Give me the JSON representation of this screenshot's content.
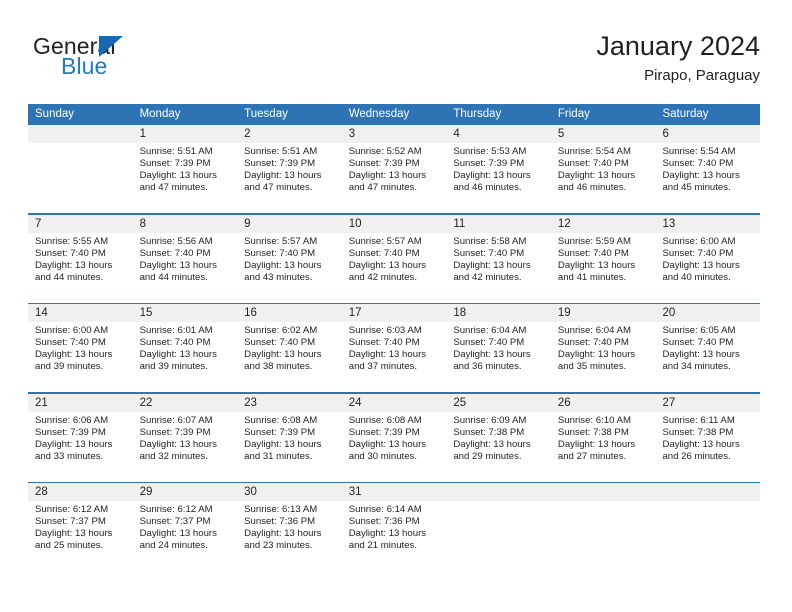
{
  "brand": {
    "name_part1": "General",
    "name_part2": "Blue",
    "accent_color": "#1668b3"
  },
  "header": {
    "title": "January 2024",
    "location": "Pirapo, Paraguay",
    "header_bg_color": "#2e74b5",
    "date_band_color": "#f0f0f0"
  },
  "weekday_headers": [
    "Sunday",
    "Monday",
    "Tuesday",
    "Wednesday",
    "Thursday",
    "Friday",
    "Saturday"
  ],
  "weeks": [
    {
      "days": [
        {
          "num": "",
          "sunrise": "",
          "sunset": "",
          "daylight_line1": "",
          "daylight_line2": ""
        },
        {
          "num": "1",
          "sunrise": "Sunrise: 5:51 AM",
          "sunset": "Sunset: 7:39 PM",
          "daylight_line1": "Daylight: 13 hours",
          "daylight_line2": "and 47 minutes."
        },
        {
          "num": "2",
          "sunrise": "Sunrise: 5:51 AM",
          "sunset": "Sunset: 7:39 PM",
          "daylight_line1": "Daylight: 13 hours",
          "daylight_line2": "and 47 minutes."
        },
        {
          "num": "3",
          "sunrise": "Sunrise: 5:52 AM",
          "sunset": "Sunset: 7:39 PM",
          "daylight_line1": "Daylight: 13 hours",
          "daylight_line2": "and 47 minutes."
        },
        {
          "num": "4",
          "sunrise": "Sunrise: 5:53 AM",
          "sunset": "Sunset: 7:39 PM",
          "daylight_line1": "Daylight: 13 hours",
          "daylight_line2": "and 46 minutes."
        },
        {
          "num": "5",
          "sunrise": "Sunrise: 5:54 AM",
          "sunset": "Sunset: 7:40 PM",
          "daylight_line1": "Daylight: 13 hours",
          "daylight_line2": "and 46 minutes."
        },
        {
          "num": "6",
          "sunrise": "Sunrise: 5:54 AM",
          "sunset": "Sunset: 7:40 PM",
          "daylight_line1": "Daylight: 13 hours",
          "daylight_line2": "and 45 minutes."
        }
      ]
    },
    {
      "days": [
        {
          "num": "7",
          "sunrise": "Sunrise: 5:55 AM",
          "sunset": "Sunset: 7:40 PM",
          "daylight_line1": "Daylight: 13 hours",
          "daylight_line2": "and 44 minutes."
        },
        {
          "num": "8",
          "sunrise": "Sunrise: 5:56 AM",
          "sunset": "Sunset: 7:40 PM",
          "daylight_line1": "Daylight: 13 hours",
          "daylight_line2": "and 44 minutes."
        },
        {
          "num": "9",
          "sunrise": "Sunrise: 5:57 AM",
          "sunset": "Sunset: 7:40 PM",
          "daylight_line1": "Daylight: 13 hours",
          "daylight_line2": "and 43 minutes."
        },
        {
          "num": "10",
          "sunrise": "Sunrise: 5:57 AM",
          "sunset": "Sunset: 7:40 PM",
          "daylight_line1": "Daylight: 13 hours",
          "daylight_line2": "and 42 minutes."
        },
        {
          "num": "11",
          "sunrise": "Sunrise: 5:58 AM",
          "sunset": "Sunset: 7:40 PM",
          "daylight_line1": "Daylight: 13 hours",
          "daylight_line2": "and 42 minutes."
        },
        {
          "num": "12",
          "sunrise": "Sunrise: 5:59 AM",
          "sunset": "Sunset: 7:40 PM",
          "daylight_line1": "Daylight: 13 hours",
          "daylight_line2": "and 41 minutes."
        },
        {
          "num": "13",
          "sunrise": "Sunrise: 6:00 AM",
          "sunset": "Sunset: 7:40 PM",
          "daylight_line1": "Daylight: 13 hours",
          "daylight_line2": "and 40 minutes."
        }
      ]
    },
    {
      "days": [
        {
          "num": "14",
          "sunrise": "Sunrise: 6:00 AM",
          "sunset": "Sunset: 7:40 PM",
          "daylight_line1": "Daylight: 13 hours",
          "daylight_line2": "and 39 minutes."
        },
        {
          "num": "15",
          "sunrise": "Sunrise: 6:01 AM",
          "sunset": "Sunset: 7:40 PM",
          "daylight_line1": "Daylight: 13 hours",
          "daylight_line2": "and 39 minutes."
        },
        {
          "num": "16",
          "sunrise": "Sunrise: 6:02 AM",
          "sunset": "Sunset: 7:40 PM",
          "daylight_line1": "Daylight: 13 hours",
          "daylight_line2": "and 38 minutes."
        },
        {
          "num": "17",
          "sunrise": "Sunrise: 6:03 AM",
          "sunset": "Sunset: 7:40 PM",
          "daylight_line1": "Daylight: 13 hours",
          "daylight_line2": "and 37 minutes."
        },
        {
          "num": "18",
          "sunrise": "Sunrise: 6:04 AM",
          "sunset": "Sunset: 7:40 PM",
          "daylight_line1": "Daylight: 13 hours",
          "daylight_line2": "and 36 minutes."
        },
        {
          "num": "19",
          "sunrise": "Sunrise: 6:04 AM",
          "sunset": "Sunset: 7:40 PM",
          "daylight_line1": "Daylight: 13 hours",
          "daylight_line2": "and 35 minutes."
        },
        {
          "num": "20",
          "sunrise": "Sunrise: 6:05 AM",
          "sunset": "Sunset: 7:40 PM",
          "daylight_line1": "Daylight: 13 hours",
          "daylight_line2": "and 34 minutes."
        }
      ]
    },
    {
      "days": [
        {
          "num": "21",
          "sunrise": "Sunrise: 6:06 AM",
          "sunset": "Sunset: 7:39 PM",
          "daylight_line1": "Daylight: 13 hours",
          "daylight_line2": "and 33 minutes."
        },
        {
          "num": "22",
          "sunrise": "Sunrise: 6:07 AM",
          "sunset": "Sunset: 7:39 PM",
          "daylight_line1": "Daylight: 13 hours",
          "daylight_line2": "and 32 minutes."
        },
        {
          "num": "23",
          "sunrise": "Sunrise: 6:08 AM",
          "sunset": "Sunset: 7:39 PM",
          "daylight_line1": "Daylight: 13 hours",
          "daylight_line2": "and 31 minutes."
        },
        {
          "num": "24",
          "sunrise": "Sunrise: 6:08 AM",
          "sunset": "Sunset: 7:39 PM",
          "daylight_line1": "Daylight: 13 hours",
          "daylight_line2": "and 30 minutes."
        },
        {
          "num": "25",
          "sunrise": "Sunrise: 6:09 AM",
          "sunset": "Sunset: 7:38 PM",
          "daylight_line1": "Daylight: 13 hours",
          "daylight_line2": "and 29 minutes."
        },
        {
          "num": "26",
          "sunrise": "Sunrise: 6:10 AM",
          "sunset": "Sunset: 7:38 PM",
          "daylight_line1": "Daylight: 13 hours",
          "daylight_line2": "and 27 minutes."
        },
        {
          "num": "27",
          "sunrise": "Sunrise: 6:11 AM",
          "sunset": "Sunset: 7:38 PM",
          "daylight_line1": "Daylight: 13 hours",
          "daylight_line2": "and 26 minutes."
        }
      ]
    },
    {
      "days": [
        {
          "num": "28",
          "sunrise": "Sunrise: 6:12 AM",
          "sunset": "Sunset: 7:37 PM",
          "daylight_line1": "Daylight: 13 hours",
          "daylight_line2": "and 25 minutes."
        },
        {
          "num": "29",
          "sunrise": "Sunrise: 6:12 AM",
          "sunset": "Sunset: 7:37 PM",
          "daylight_line1": "Daylight: 13 hours",
          "daylight_line2": "and 24 minutes."
        },
        {
          "num": "30",
          "sunrise": "Sunrise: 6:13 AM",
          "sunset": "Sunset: 7:36 PM",
          "daylight_line1": "Daylight: 13 hours",
          "daylight_line2": "and 23 minutes."
        },
        {
          "num": "31",
          "sunrise": "Sunrise: 6:14 AM",
          "sunset": "Sunset: 7:36 PM",
          "daylight_line1": "Daylight: 13 hours",
          "daylight_line2": "and 21 minutes."
        },
        {
          "num": "",
          "sunrise": "",
          "sunset": "",
          "daylight_line1": "",
          "daylight_line2": ""
        },
        {
          "num": "",
          "sunrise": "",
          "sunset": "",
          "daylight_line1": "",
          "daylight_line2": ""
        },
        {
          "num": "",
          "sunrise": "",
          "sunset": "",
          "daylight_line1": "",
          "daylight_line2": ""
        }
      ]
    }
  ]
}
